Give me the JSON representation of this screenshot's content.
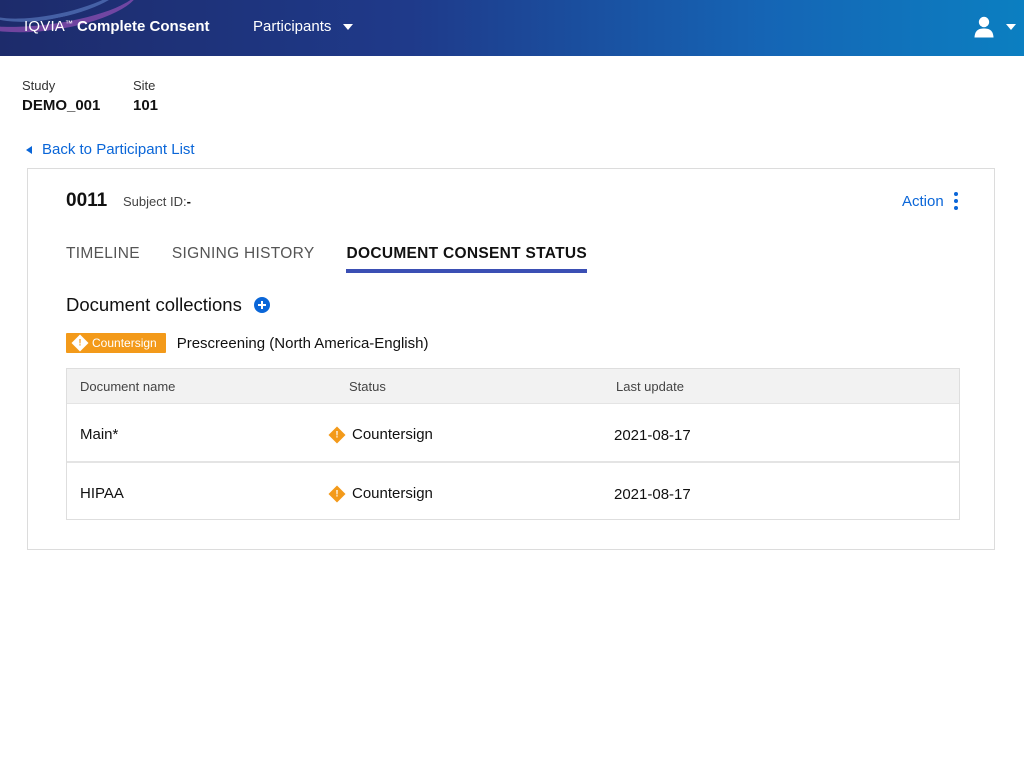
{
  "header": {
    "company": "IQVIA",
    "trademark": "™",
    "product": "Complete Consent",
    "nav_label": "Participants",
    "icons": {
      "user": "user-icon",
      "menu_caret": "chevron-down-icon"
    }
  },
  "meta": {
    "study_label": "Study",
    "study_value": "DEMO_001",
    "site_label": "Site",
    "site_value": "101"
  },
  "back_link": "Back to Participant List",
  "participant": {
    "id": "0011",
    "subject_label": "Subject ID:",
    "subject_value": "-",
    "action_label": "Action"
  },
  "tabs": [
    {
      "label": "TIMELINE",
      "active": false
    },
    {
      "label": "SIGNING HISTORY",
      "active": false
    },
    {
      "label": "DOCUMENT CONSENT STATUS",
      "active": true
    }
  ],
  "collections": {
    "title": "Document collections",
    "badge": "Countersign",
    "collection_name": "Prescreening (North America-English)"
  },
  "table": {
    "columns": [
      "Document name",
      "Status",
      "Last update"
    ],
    "rows": [
      {
        "name": "Main*",
        "status": "Countersign",
        "updated": "2021-08-17"
      },
      {
        "name": "HIPAA",
        "status": "Countersign",
        "updated": "2021-08-17"
      }
    ]
  },
  "colors": {
    "header_start": "#1d2b6b",
    "header_end": "#0b7fc1",
    "link": "#0a66d8",
    "warning": "#f39a1a",
    "tab_indicator": "#3b4fb4"
  }
}
